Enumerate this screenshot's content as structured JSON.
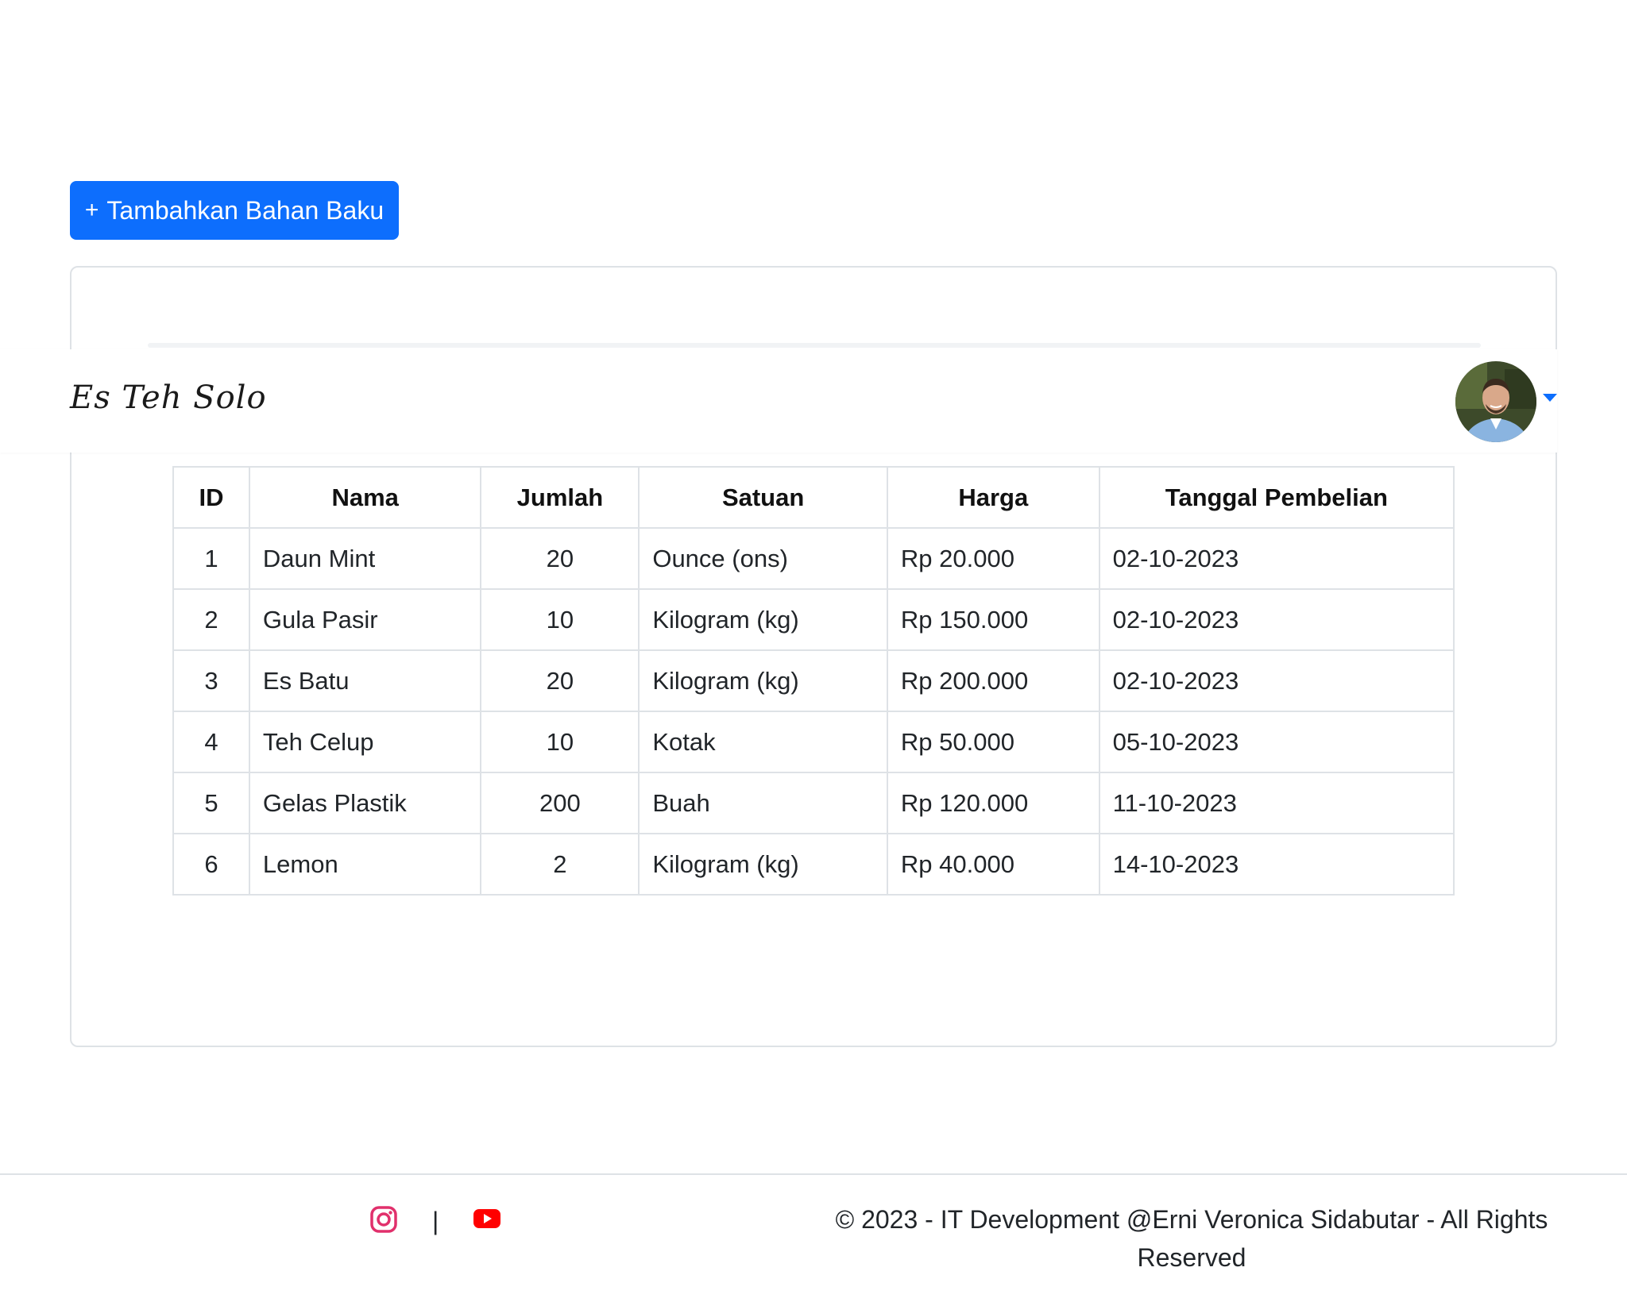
{
  "toolbar": {
    "add_label": "Tambahkan Bahan Baku",
    "add_icon": "plus-icon"
  },
  "navbar": {
    "brand": "Es Teh Solo",
    "avatar": "user-avatar",
    "caret_color": "#0d6efd"
  },
  "accent_color": "#0d6efd",
  "table": {
    "headers": [
      "ID",
      "Nama",
      "Jumlah",
      "Satuan",
      "Harga",
      "Tanggal Pembelian"
    ],
    "rows": [
      [
        "1",
        "Daun Mint",
        "20",
        "Ounce (ons)",
        "Rp 20.000",
        "02-10-2023"
      ],
      [
        "2",
        "Gula Pasir",
        "10",
        "Kilogram (kg)",
        "Rp 150.000",
        "02-10-2023"
      ],
      [
        "3",
        "Es Batu",
        "20",
        "Kilogram (kg)",
        "Rp 200.000",
        "02-10-2023"
      ],
      [
        "4",
        "Teh Celup",
        "10",
        "Kotak",
        "Rp 50.000",
        "05-10-2023"
      ],
      [
        "5",
        "Gelas Plastik",
        "200",
        "Buah",
        "Rp 120.000",
        "11-10-2023"
      ],
      [
        "6",
        "Lemon",
        "2",
        "Kilogram (kg)",
        "Rp 40.000",
        "14-10-2023"
      ]
    ]
  },
  "footer": {
    "separator": "|",
    "copyright": "© 2023 - IT Development @Erni Veronica Sidabutar - All Rights Reserved",
    "icons": [
      "instagram-icon",
      "youtube-icon"
    ]
  }
}
